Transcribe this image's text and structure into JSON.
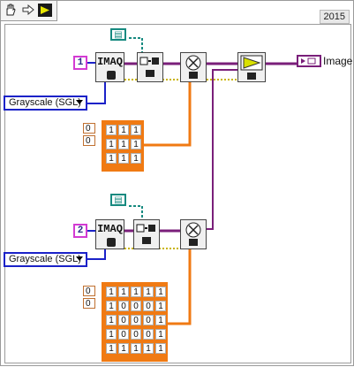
{
  "toolbar": {
    "icons": [
      "hand-icon",
      "arrow-icon",
      "labview-icon"
    ]
  },
  "version": "2015",
  "diagram": {
    "constant_1": "1",
    "constant_2": "2",
    "enum_1": "Grayscale (SGL)",
    "enum_2": "Grayscale (SGL)",
    "imaq_label": "IMAQ",
    "indicator_label": "Image",
    "kernel_3x3": [
      [
        "1",
        "1",
        "1"
      ],
      [
        "1",
        "1",
        "1"
      ],
      [
        "1",
        "1",
        "1"
      ]
    ],
    "kernel_5x5": [
      [
        "1",
        "1",
        "1",
        "1",
        "1"
      ],
      [
        "1",
        "0",
        "0",
        "0",
        "1"
      ],
      [
        "1",
        "0",
        "0",
        "0",
        "1"
      ],
      [
        "1",
        "0",
        "0",
        "0",
        "1"
      ],
      [
        "1",
        "1",
        "1",
        "1",
        "1"
      ]
    ],
    "index_1": [
      "0",
      "0"
    ],
    "index_2": [
      "0",
      "0"
    ]
  },
  "colors": {
    "wire_image": "#7a1f7a",
    "wire_array": "#f07a13",
    "enum_border": "#1b22c8",
    "const_border": "#d33bd3"
  }
}
